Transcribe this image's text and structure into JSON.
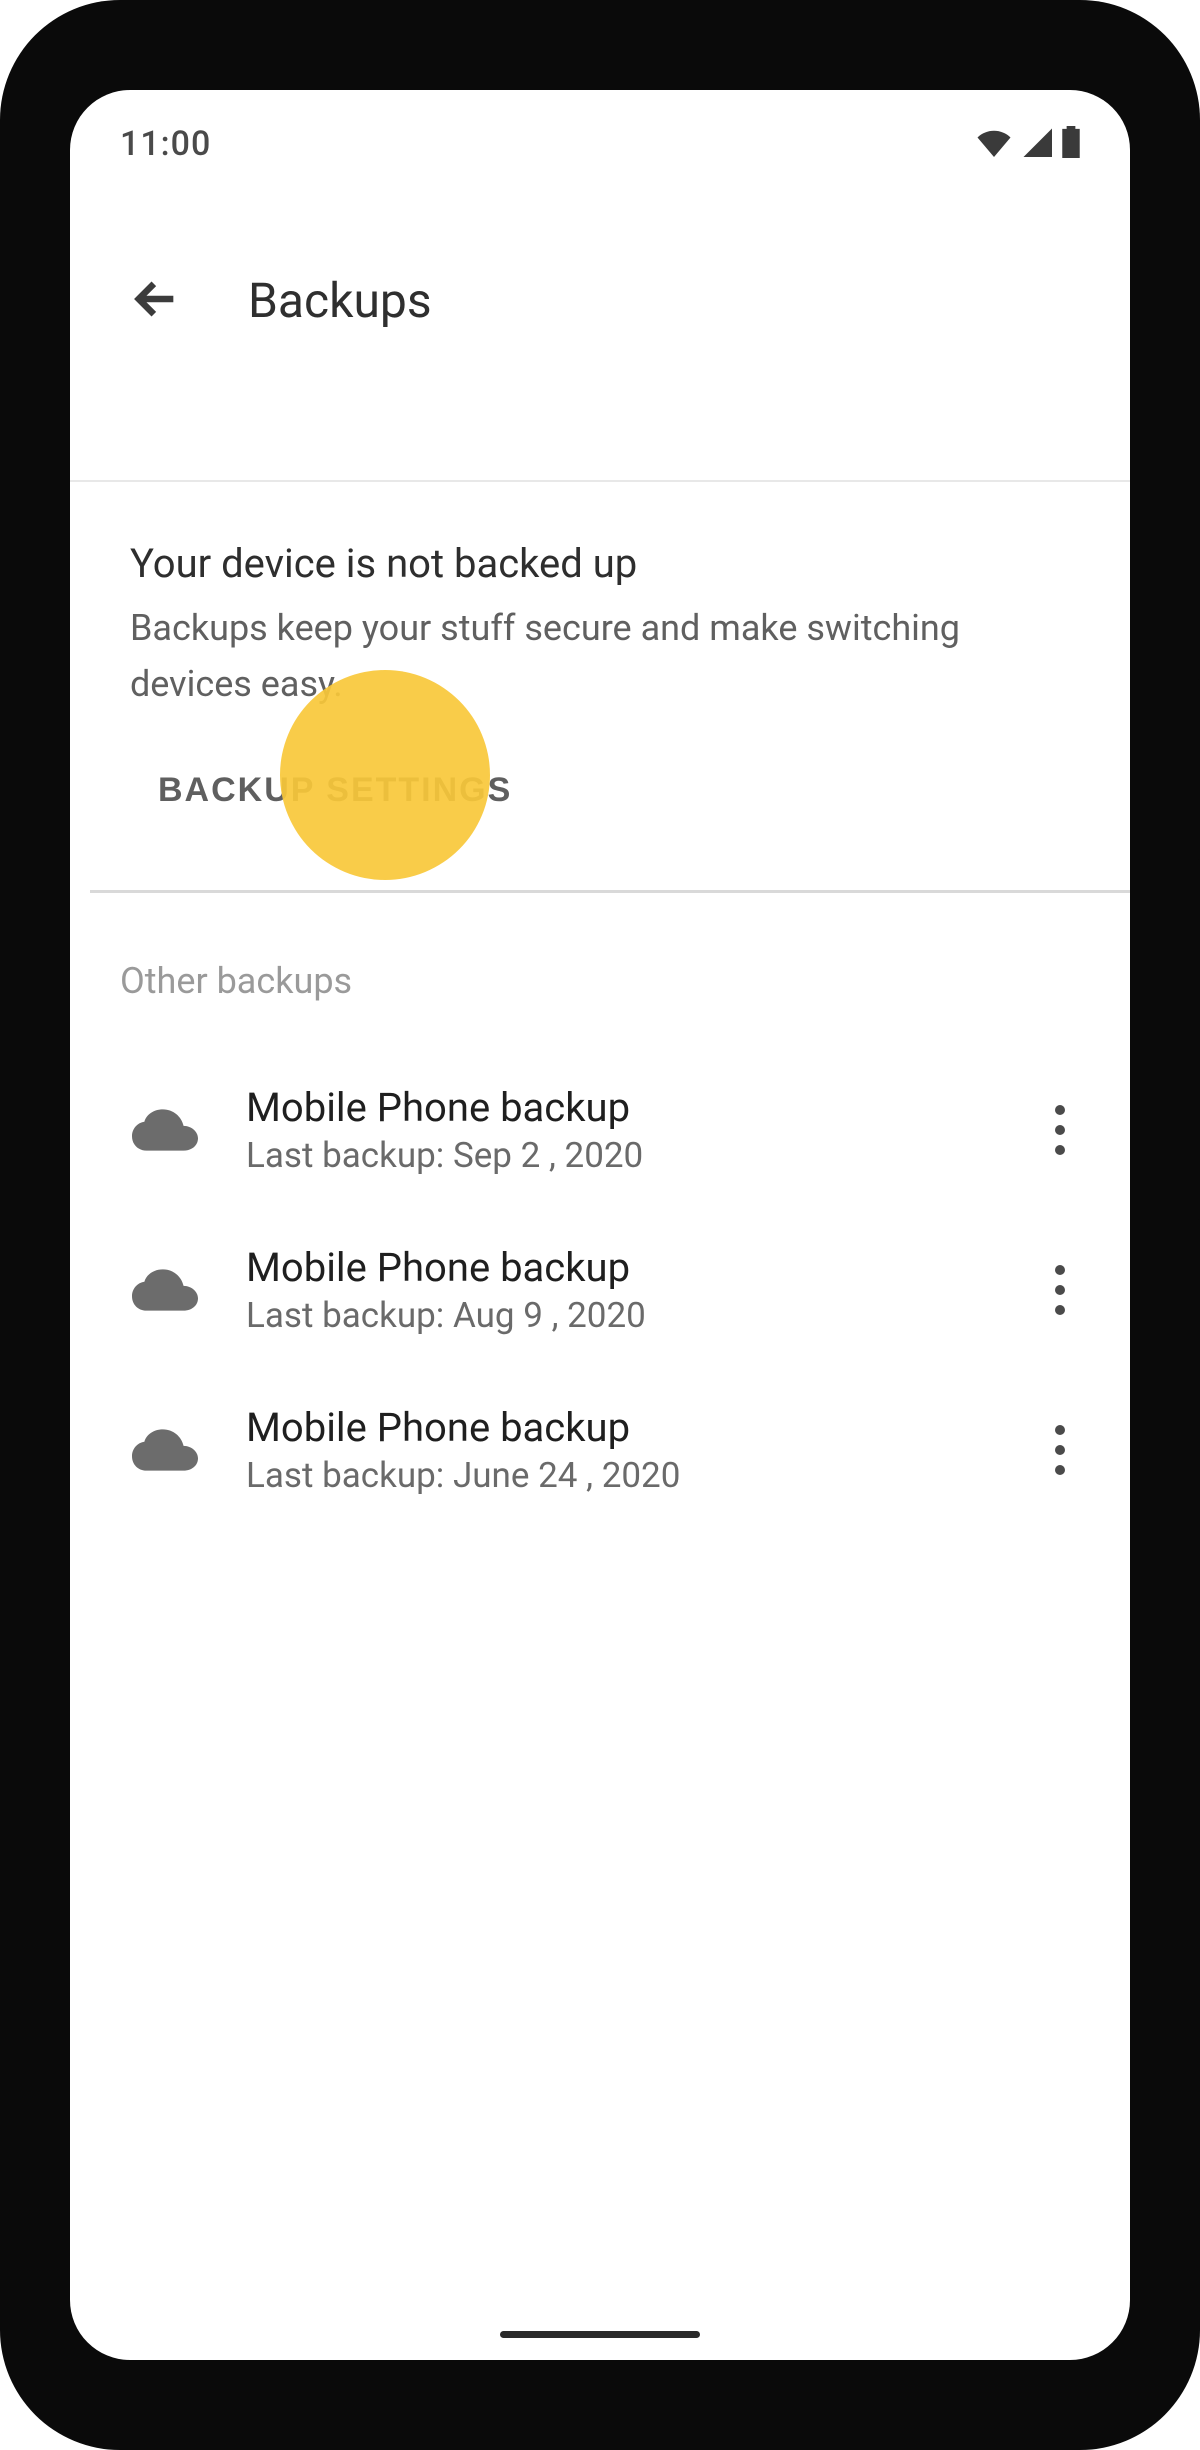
{
  "status": {
    "time": "11:00"
  },
  "app_bar": {
    "title": "Backups"
  },
  "warn": {
    "title": "Your device is not backed up",
    "subtitle": "Backups keep your stuff secure and make switching devices easy.",
    "action_label": "BACKUP SETTINGS"
  },
  "section_header": "Other backups",
  "backups": [
    {
      "title": "Mobile Phone backup",
      "subtitle": "Last backup: Sep 2 , 2020"
    },
    {
      "title": "Mobile Phone backup",
      "subtitle": "Last backup: Aug 9 , 2020"
    },
    {
      "title": "Mobile Phone backup",
      "subtitle": "Last backup: June 24 , 2020"
    }
  ]
}
